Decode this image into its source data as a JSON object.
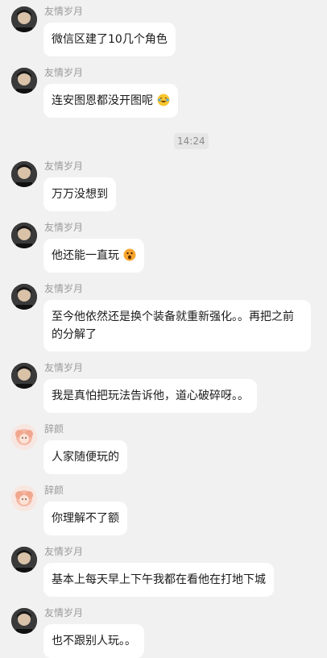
{
  "friend_name": "友情岁月",
  "other_name": "辞颜",
  "timestamp": "14:24",
  "messages": [
    {
      "text": "微信区建了10几个角色"
    },
    {
      "text": "连安图恩都没开图呢",
      "emoji": "laughing-tears-emoji"
    },
    {
      "text": "万万没想到"
    },
    {
      "text": "他还能一直玩",
      "emoji": "surprised-emoji"
    },
    {
      "text": "至今他依然还是换个装备就重新强化。。再把之前的分解了"
    },
    {
      "text": "我是真怕把玩法告诉他，道心破碎呀。。"
    },
    {
      "text": "人家随便玩的"
    },
    {
      "text": "你理解不了额"
    },
    {
      "text": "基本上每天早上下午我都在看他在打地下城"
    },
    {
      "text": "也不跟别人玩。。"
    }
  ],
  "colors": {
    "background": "#f1f1f1",
    "bubble": "#ffffff",
    "name": "#9a9a9a",
    "text": "#1a1a1a"
  }
}
